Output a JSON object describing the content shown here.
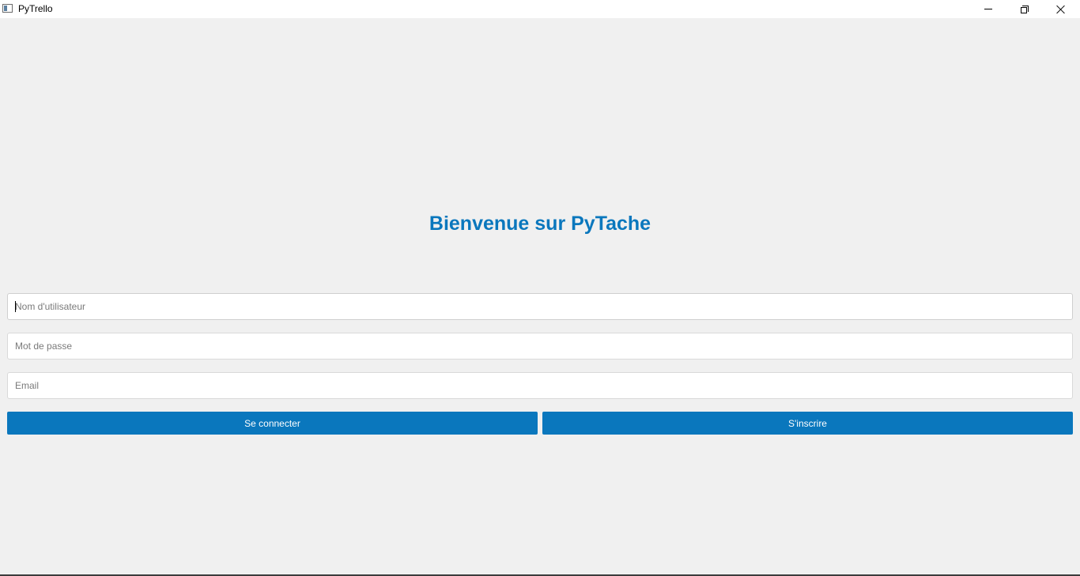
{
  "window": {
    "title": "PyTrello",
    "controls": {
      "minimize_icon": "minimize-icon",
      "maximize_icon": "restore-icon",
      "close_icon": "close-icon"
    }
  },
  "main": {
    "heading": "Bienvenue sur PyTache",
    "fields": {
      "username": {
        "value": "",
        "placeholder": "Nom d'utilisateur"
      },
      "password": {
        "value": "",
        "placeholder": "Mot de passe"
      },
      "email": {
        "value": "",
        "placeholder": "Email"
      }
    },
    "buttons": {
      "login": "Se connecter",
      "signup": "S'inscrire"
    }
  },
  "colors": {
    "accent": "#0a77bd",
    "background": "#f0f0f0"
  }
}
